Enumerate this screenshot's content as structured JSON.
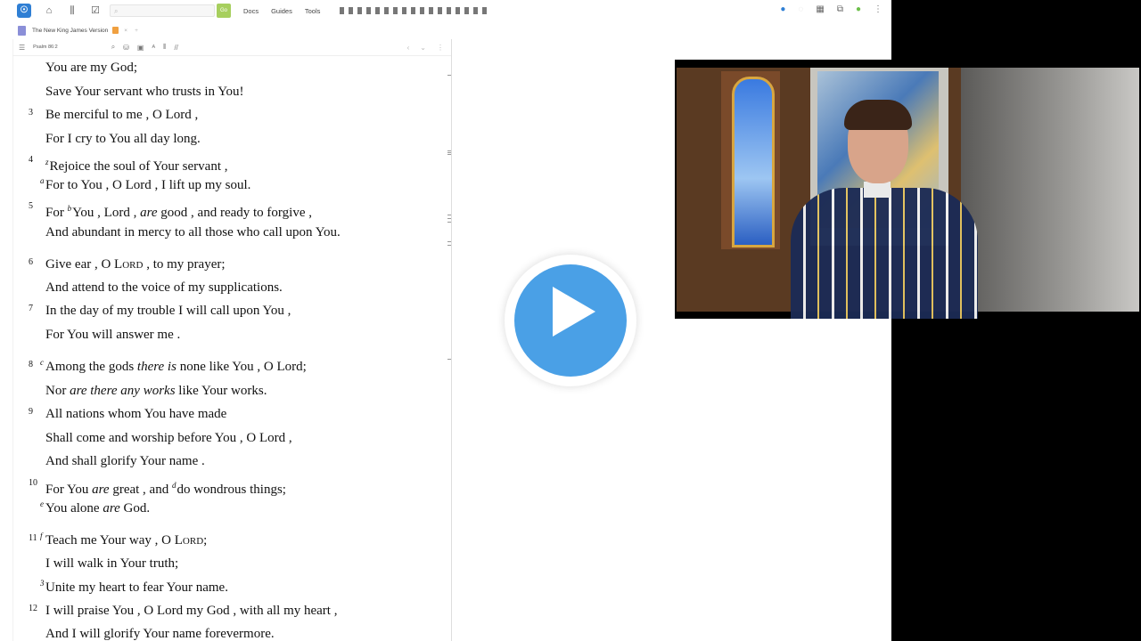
{
  "app": {
    "logo_glyph": "☉",
    "search_placeholder": "",
    "go_label": "Go",
    "nav": [
      "Docs",
      "Guides",
      "Tools"
    ]
  },
  "tab": {
    "title": "The New King James Version",
    "close": "×",
    "add": "+"
  },
  "toolbar": {
    "reference": "Psalm 86:2"
  },
  "verses": [
    {
      "num": "",
      "fn": "",
      "html": "You are my God;"
    },
    {
      "num": "",
      "fn": "",
      "html": "Save Your servant who trusts in You!"
    },
    {
      "num": "3",
      "fn": "",
      "html": "Be merciful to me , O Lord ,"
    },
    {
      "num": "",
      "fn": "",
      "html": "For I cry to You all day long."
    },
    {
      "num": "4",
      "fn": "",
      "html": "<sup>z</sup>Rejoice the soul of Your servant ,"
    },
    {
      "num": "",
      "fn": "a",
      "html": "For to You , O Lord , I lift up my soul."
    },
    {
      "num": "5",
      "fn": "",
      "html": "For <sup>b</sup>You , Lord , <i>are</i> good , and ready to forgive ,"
    },
    {
      "num": "",
      "fn": "",
      "html": "And abundant in mercy to all those who call upon You."
    },
    {
      "num": "6",
      "fn": "",
      "html": "Give ear , O L<span style=\"font-size:11px\">ORD</span> , to my prayer;"
    },
    {
      "num": "",
      "fn": "",
      "html": "And attend to the voice of my supplications."
    },
    {
      "num": "7",
      "fn": "",
      "html": "In the day of my trouble I will call upon You ,"
    },
    {
      "num": "",
      "fn": "",
      "html": "For You will answer me ."
    },
    {
      "num": "8",
      "fn": "c",
      "html": "Among the gods <i>there is</i> none like You , O Lord;"
    },
    {
      "num": "",
      "fn": "",
      "html": "Nor <i>are there any works</i> like Your works."
    },
    {
      "num": "9",
      "fn": "",
      "html": "All nations whom You have made"
    },
    {
      "num": "",
      "fn": "",
      "html": "Shall come and worship before You , O Lord ,"
    },
    {
      "num": "",
      "fn": "",
      "html": "And shall glorify Your name ."
    },
    {
      "num": "10",
      "fn": "",
      "html": "For You <i>are</i> great , and <sup>d</sup>do wondrous things;"
    },
    {
      "num": "",
      "fn": "e",
      "html": "You alone <i>are</i> God."
    },
    {
      "num": "11",
      "fn": "f",
      "html": "Teach me Your way , O L<span style=\"font-size:11px\">ORD</span>;"
    },
    {
      "num": "",
      "fn": "",
      "html": "I will walk in Your truth;"
    },
    {
      "num": "",
      "fn": "3",
      "html": "Unite my heart to fear Your name."
    },
    {
      "num": "12",
      "fn": "",
      "html": "I will praise You , O Lord my God , with all my heart ,"
    },
    {
      "num": "",
      "fn": "",
      "html": "And I will glorify Your name forevermore."
    }
  ],
  "colors": {
    "accent": "#2f7fd4",
    "play": "#4aa0e6",
    "go": "#a7cf5e"
  },
  "icons": {
    "play": "play-icon",
    "home": "home-icon",
    "library": "library-icon"
  }
}
